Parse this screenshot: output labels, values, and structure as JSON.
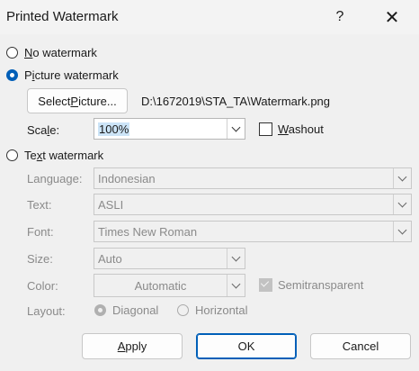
{
  "dialog": {
    "title": "Printed Watermark",
    "help_label": "?",
    "close_label": "✕"
  },
  "options": {
    "no_watermark": {
      "prefix": "",
      "accel": "N",
      "rest": "o watermark",
      "selected": false
    },
    "picture_watermark": {
      "prefix": "",
      "accel": "i",
      "rest": "cture watermark",
      "pre": "P",
      "selected": true
    },
    "text_watermark": {
      "accel": "x",
      "pre": "Te",
      "rest": "t watermark",
      "selected": false
    }
  },
  "picture": {
    "select_button": {
      "pre": "Select ",
      "accel": "P",
      "rest": "icture..."
    },
    "file_path": "D:\\1672019\\STA_TA\\Watermark.png",
    "scale_label": {
      "pre": "Sca",
      "accel": "l",
      "rest": "e:"
    },
    "scale_value": "100%",
    "washout": {
      "accel": "W",
      "rest": "ashout",
      "checked": false
    }
  },
  "text": {
    "language_label": "Language:",
    "language_value": "Indonesian",
    "text_label": "Text:",
    "text_value": "ASLI",
    "font_label": "Font:",
    "font_value": "Times New Roman",
    "size_label": "Size:",
    "size_value": "Auto",
    "color_label": "Color:",
    "color_value": "Automatic",
    "semitransparent_label": "Semitransparent",
    "layout_label": "Layout:",
    "diagonal_label": "Diagonal",
    "horizontal_label": "Horizontal"
  },
  "buttons": {
    "apply": {
      "accel": "A",
      "rest": "pply"
    },
    "ok": "OK",
    "cancel": "Cancel"
  }
}
